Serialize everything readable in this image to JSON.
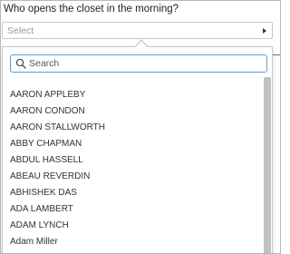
{
  "question": {
    "text": "Who opens the closet in the morning?"
  },
  "select": {
    "value": "Select"
  },
  "search": {
    "placeholder": "Search"
  },
  "options": [
    "AARON APPLEBY",
    "AARON CONDON",
    "AARON STALLWORTH",
    "ABBY CHAPMAN",
    "ABDUL HASSELL",
    "ABEAU REVERDIN",
    "ABHISHEK DAS",
    "ADA LAMBERT",
    "ADAM LYNCH",
    "Adam Miller"
  ],
  "colors": {
    "search_border": "#5b9bd5",
    "accent_line": "#3b7fc4"
  }
}
